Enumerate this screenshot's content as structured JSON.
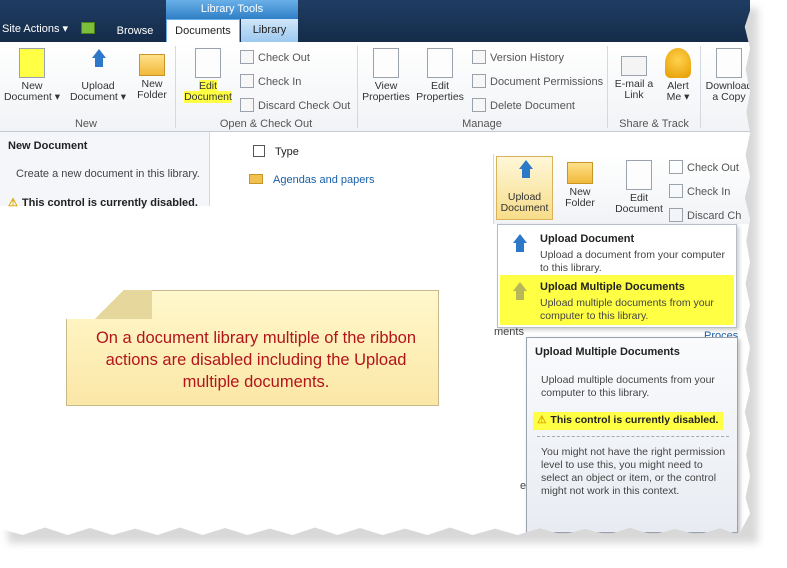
{
  "topbar": {
    "site_actions": "Site Actions ▾",
    "tabs": {
      "browse": "Browse",
      "documents": "Documents",
      "library": "Library"
    },
    "context_header": "Library Tools"
  },
  "ribbon": {
    "new_document": "New Document ▾",
    "upload_document": "Upload Document ▾",
    "new_folder": "New Folder",
    "edit_document": "Edit Document",
    "check_out": "Check Out",
    "check_in": "Check In",
    "discard_check_out": "Discard Check Out",
    "view_properties": "View Properties",
    "edit_properties": "Edit Properties",
    "version_history": "Version History",
    "document_permissions": "Document Permissions",
    "delete_document": "Delete Document",
    "email_link": "E-mail a Link",
    "alert_me": "Alert Me ▾",
    "download_copy": "Download a Copy",
    "groups": {
      "new": "New",
      "open_check_out": "Open & Check Out",
      "manage": "Manage",
      "share_track": "Share & Track"
    }
  },
  "left_panel": {
    "title": "New Document",
    "desc": "Create a new document in this library.",
    "warning": "This control is currently disabled."
  },
  "list": {
    "type_header": "Type",
    "folder_name": "Agendas and papers"
  },
  "zoom_ribbon": {
    "upload_document": "Upload Document",
    "new_folder": "New Folder",
    "edit_document": "Edit Document",
    "check_out": "Check Out",
    "check_in": "Check In",
    "discard": "Discard Ch"
  },
  "menu": {
    "item1_title": "Upload Document",
    "item1_desc": "Upload a document from your computer to this library.",
    "item2_title": "Upload Multiple Documents",
    "item2_desc": "Upload multiple documents from your computer to this library."
  },
  "tooltip": {
    "title": "Upload Multiple Documents",
    "desc": "Upload multiple documents from your computer to this library.",
    "warning": "This control is currently disabled.",
    "body": "You might not have the right permission level to use this, you might need to select an object or item, or the control might not work in this context."
  },
  "stray": {
    "ments": "ments",
    "proces": "Proces",
    "e": "e"
  },
  "note": {
    "text": "On a document library multiple of the ribbon actions are disabled including the Upload multiple documents."
  }
}
